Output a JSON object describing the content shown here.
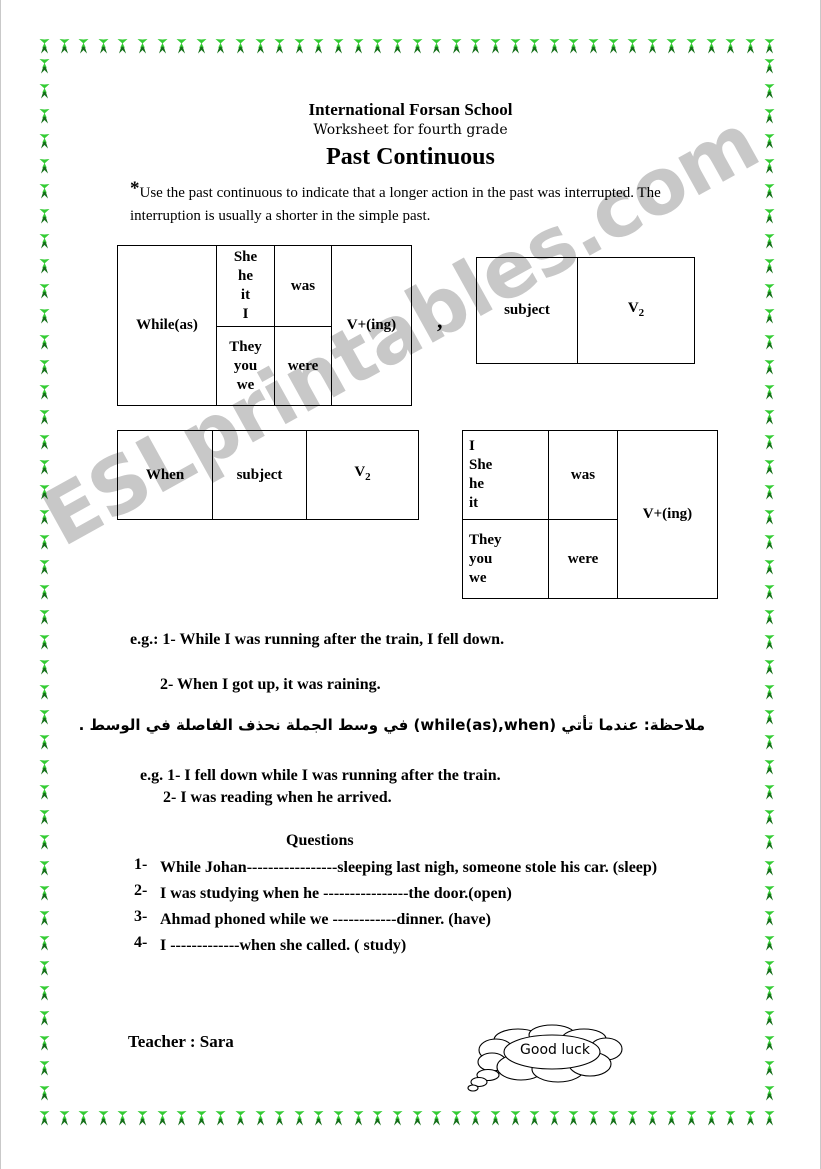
{
  "document": {
    "school_name": "International Forsan School",
    "subtitle": "Worksheet for fourth grade",
    "title": "Past Continuous",
    "intro_star": "*",
    "intro_text": "Use the past continuous to indicate that a longer action in the past was interrupted. The interruption is usually a shorter in the simple past.",
    "comma_separator": ",",
    "watermark": "ESLprintables.com"
  },
  "tables": {
    "table_while": {
      "conjunction": "While(as)",
      "pronouns_singular": "She\nhe\nit\nI",
      "aux_singular": "was",
      "pronouns_plural": "They\nyou\nwe",
      "aux_plural": "were",
      "verb_form": "V+(ing)"
    },
    "table_subject_v2": {
      "subject": "subject",
      "verb": "V",
      "verb_sub": "2"
    },
    "table_when": {
      "conjunction": "When",
      "subject": "subject",
      "verb": "V",
      "verb_sub": "2"
    },
    "table_pronoun_ving": {
      "pronouns_singular": "I\nShe\nhe\nit",
      "aux_singular": "was",
      "pronouns_plural": "They\nyou\nwe",
      "aux_plural": "were",
      "verb_form": "V+(ing)"
    }
  },
  "examples": {
    "group1_label": "e.g.: 1- While I was running after the train, I fell down.",
    "group1_item2": "2- When I got up, it was raining.",
    "arabic_note": "ملاحظة: عندما تأتي (while(as),when) في وسط الجملة نحذف الفاصلة في الوسط .",
    "group2_item1": "e.g. 1- I fell down while I was running after the train.",
    "group2_item2": "2- I was reading when he arrived."
  },
  "questions": {
    "heading": "Questions",
    "items": [
      {
        "number": "1-",
        "text": "While Johan-----------------sleeping last nigh, someone stole his car. (sleep)"
      },
      {
        "number": "2-",
        "text": "I was studying when he ----------------the door.(open)"
      },
      {
        "number": "3-",
        "text": "Ahmad phoned while we ------------dinner.  (have)"
      },
      {
        "number": "4-",
        "text": "I -------------when she called. ( study)"
      }
    ]
  },
  "footer": {
    "teacher": "Teacher : Sara",
    "good_luck": "Good luck"
  },
  "colors": {
    "bow_light": "#33cc33",
    "bow_dark": "#15701a",
    "watermark": "#c8c8c8",
    "page_edge": "#c9c9c9"
  }
}
